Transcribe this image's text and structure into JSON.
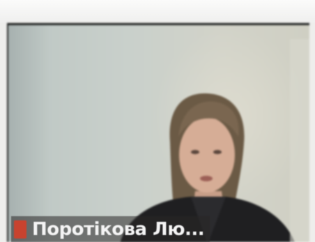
{
  "participant": {
    "name": "Поротікова Лю..."
  },
  "colors": {
    "mic_muted": "#c8432f",
    "wall": "#c9d0cb",
    "hair": "#6b5a45",
    "jacket": "#1f1f21"
  },
  "icons": {
    "mic_indicator": "mic-muted-icon"
  }
}
